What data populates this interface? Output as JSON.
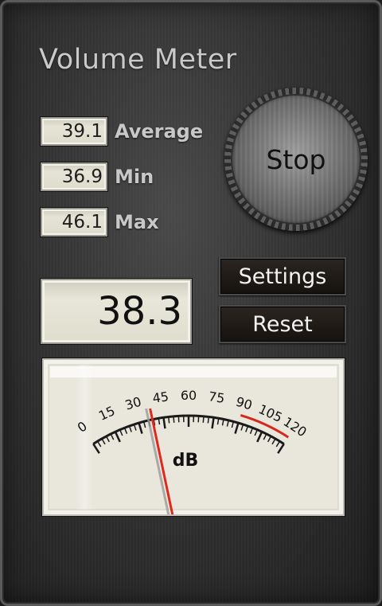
{
  "app": {
    "title": "Volume Meter"
  },
  "stats": {
    "average": {
      "value": "39.1",
      "label": "Average"
    },
    "min": {
      "value": "36.9",
      "label": "Min"
    },
    "max": {
      "value": "46.1",
      "label": "Max"
    }
  },
  "controls": {
    "stop_label": "Stop",
    "settings_label": "Settings",
    "reset_label": "Reset"
  },
  "current_level": "38.3",
  "meter": {
    "unit_label": "dB",
    "scale_min": 0,
    "scale_max": 120,
    "ticks": [
      "0",
      "15",
      "30",
      "45",
      "60",
      "75",
      "90",
      "105",
      "120"
    ],
    "needle_value": 38.3,
    "red_zone_start": 90,
    "colors": {
      "needle": "#e0291e",
      "red_zone": "#d9261c",
      "scale": "#1a1a1a"
    }
  }
}
